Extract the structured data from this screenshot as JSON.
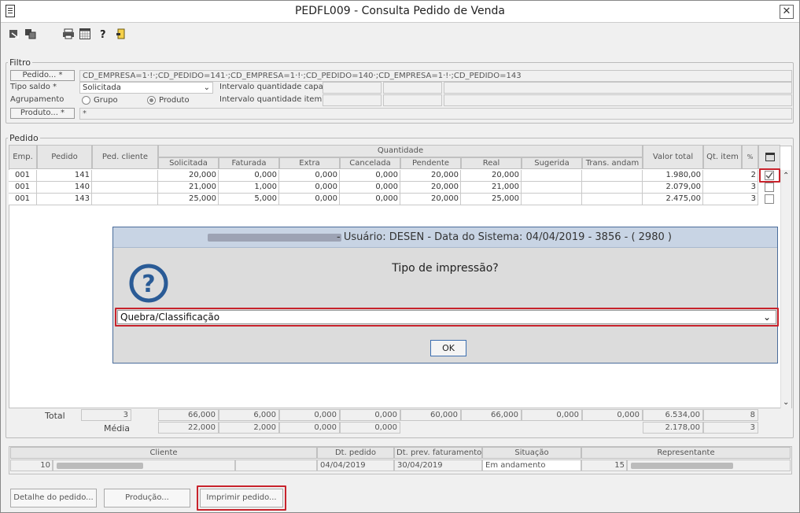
{
  "window": {
    "title": "PEDFL009 - Consulta Pedido de Venda",
    "close": "✕"
  },
  "toolbar": {
    "icons": [
      "export-icon",
      "copy-icon",
      "print-icon",
      "calendar-icon",
      "help-icon",
      "exit-icon"
    ]
  },
  "filtro": {
    "legend": "Filtro",
    "pedido_btn": "Pedido... *",
    "pedido_value": "CD_EMPRESA=1·!·;CD_PEDIDO=141·;CD_EMPRESA=1·!·;CD_PEDIDO=140·;CD_EMPRESA=1·!·;CD_PEDIDO=143",
    "tipo_saldo_label": "Tipo saldo *",
    "tipo_saldo_value": "Solicitada",
    "agrupamento_label": "Agrupamento",
    "opt_grupo": "Grupo",
    "opt_produto": "Produto",
    "intervalo_capa": "Intervalo quantidade capa",
    "intervalo_item": "Intervalo quantidade item",
    "produto_btn": "Produto... *",
    "produto_value": "*"
  },
  "pedido": {
    "legend": "Pedido",
    "headers": {
      "emp": "Emp.",
      "pedido": "Pedido",
      "ped_cliente": "Ped. cliente",
      "quantidade": "Quantidade",
      "solicitada": "Solicitada",
      "faturada": "Faturada",
      "extra": "Extra",
      "cancelada": "Cancelada",
      "pendente": "Pendente",
      "real": "Real",
      "sugerida": "Sugerida",
      "trans": "Trans. andam",
      "valor_total": "Valor total",
      "qt_item": "Qt. item",
      "pct": "%"
    },
    "rows": [
      {
        "emp": "001",
        "pedido": "141",
        "ped_cliente": "",
        "solicitada": "20,000",
        "faturada": "0,000",
        "extra": "0,000",
        "cancelada": "0,000",
        "pendente": "20,000",
        "real": "20,000",
        "sugerida": "",
        "trans": "",
        "valor_total": "1.980,00",
        "qt_item": "2",
        "checked": true
      },
      {
        "emp": "001",
        "pedido": "140",
        "ped_cliente": "",
        "solicitada": "21,000",
        "faturada": "1,000",
        "extra": "0,000",
        "cancelada": "0,000",
        "pendente": "20,000",
        "real": "21,000",
        "sugerida": "",
        "trans": "",
        "valor_total": "2.079,00",
        "qt_item": "3",
        "checked": false
      },
      {
        "emp": "001",
        "pedido": "143",
        "ped_cliente": "",
        "solicitada": "25,000",
        "faturada": "5,000",
        "extra": "0,000",
        "cancelada": "0,000",
        "pendente": "20,000",
        "real": "25,000",
        "sugerida": "",
        "trans": "",
        "valor_total": "2.475,00",
        "qt_item": "3",
        "checked": false
      }
    ],
    "total_label": "Total",
    "media_label": "Média",
    "total": {
      "count": "3",
      "solicitada": "66,000",
      "faturada": "6,000",
      "extra": "0,000",
      "cancelada": "0,000",
      "pendente": "60,000",
      "real": "66,000",
      "sugerida": "0,000",
      "trans": "0,000",
      "valor_total": "6.534,00",
      "qt_item": "8"
    },
    "media": {
      "solicitada": "22,000",
      "faturada": "2,000",
      "extra": "0,000",
      "cancelada": "0,000",
      "valor_total": "2.178,00",
      "qt_item": "3"
    }
  },
  "info": {
    "cliente_h": "Cliente",
    "dt_pedido_h": "Dt. pedido",
    "dt_prev_h": "Dt. prev. faturamento",
    "situacao_h": "Situação",
    "representante_h": "Representante",
    "cliente_code": "10",
    "dt_pedido": "04/04/2019",
    "dt_prev": "30/04/2019",
    "situacao": "Em andamento",
    "representante_code": "15"
  },
  "buttons": {
    "detalhe": "Detalhe do pedido...",
    "producao": "Produção...",
    "imprimir": "Imprimir pedido..."
  },
  "dialog": {
    "title": "- Usuário: DESEN - Data do Sistema: 04/04/2019 - 3856 - ( 2980 )",
    "question": "Tipo de impressão?",
    "select_value": "Quebra/Classificação",
    "ok": "OK"
  },
  "colors": {
    "highlight": "#c8232c",
    "dialog_title": "#c8d4e4",
    "icon_blue": "#2a5b96"
  }
}
